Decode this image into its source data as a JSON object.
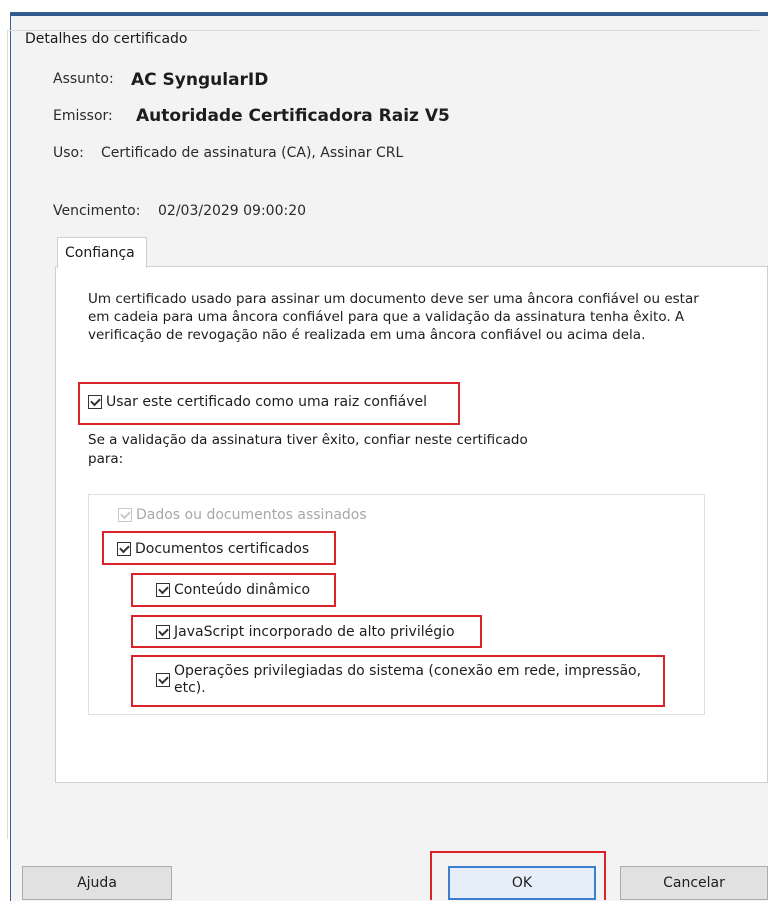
{
  "dialog": {
    "group_title": "Detalhes do certificado",
    "subject_label": "Assunto:",
    "subject_value": "AC SyngularID",
    "issuer_label": "Emissor:",
    "issuer_value": "Autoridade Certificadora Raiz V5",
    "usage_label": "Uso:",
    "usage_value": "Certificado de assinatura (CA), Assinar CRL",
    "expiry_label": "Vencimento:",
    "expiry_value": "02/03/2029 09:00:20"
  },
  "tab": {
    "label": "Confiança",
    "description": "Um certificado usado para assinar um documento deve ser uma âncora confiável ou estar em cadeia para uma âncora confiável para que a validação da assinatura tenha êxito. A verificação de revogação não é realizada em uma âncora confiável ou acima dela.",
    "trusted_root_label": "Usar este certificado como uma raiz confiável",
    "trusted_root_checked": true,
    "trust_intro": "Se a validação da assinatura tiver êxito, confiar neste certificado para:",
    "options": [
      {
        "label": "Dados ou documentos assinados",
        "checked": true,
        "enabled": false
      },
      {
        "label": "Documentos certificados",
        "checked": true,
        "enabled": true
      },
      {
        "label": "Conteúdo dinâmico",
        "checked": true,
        "enabled": true
      },
      {
        "label": "JavaScript incorporado de alto privilégio",
        "checked": true,
        "enabled": true
      },
      {
        "label": "Operações privilegiadas do sistema (conexão em rede, impressão, etc).",
        "checked": true,
        "enabled": true
      }
    ]
  },
  "buttons": {
    "help": "Ajuda",
    "ok": "OK",
    "cancel": "Cancelar"
  },
  "colors": {
    "highlight": "#d9242b",
    "window_border": "#2f5a8f",
    "ok_border": "#3c7fd1"
  }
}
